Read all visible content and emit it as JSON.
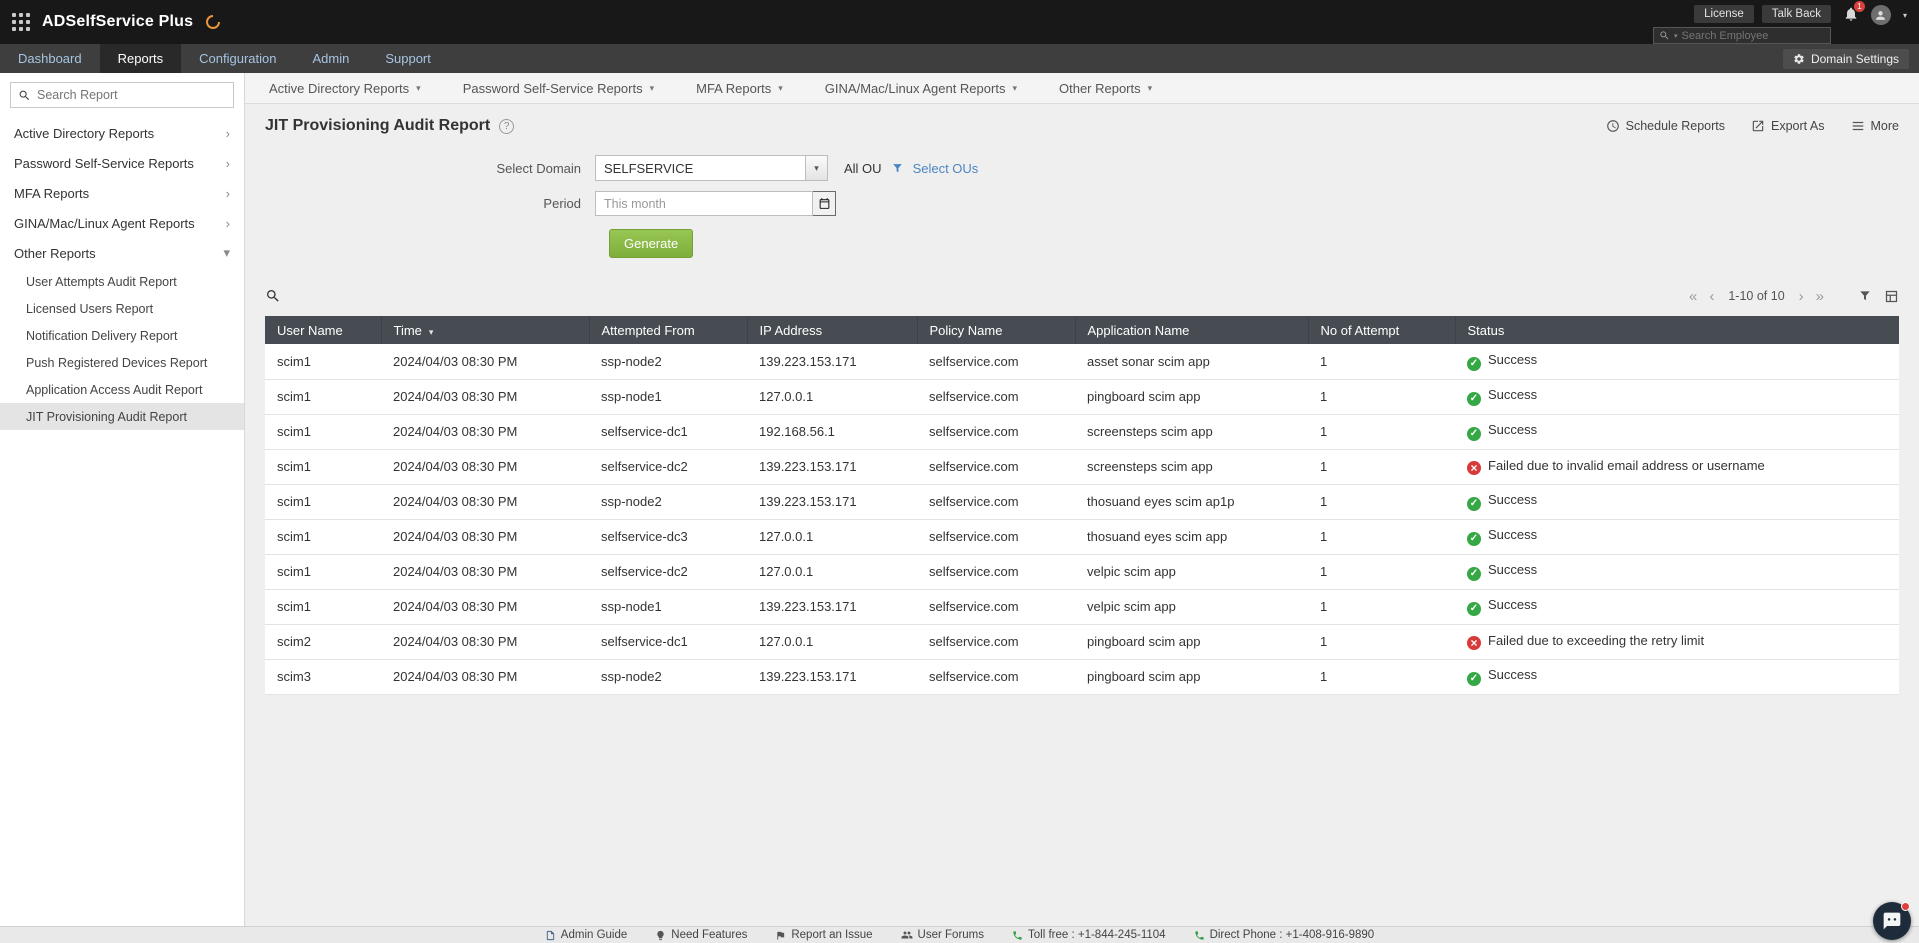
{
  "icons": {
    "caret_down": "▾",
    "chevron_right": "›",
    "first_page": "«",
    "prev_page": "‹",
    "next_page": "›",
    "last_page": "»",
    "help": "?"
  },
  "topbar": {
    "app_name": "ADSelfService Plus",
    "license": "License",
    "talk_back": "Talk Back",
    "bell_badge": "1",
    "search_placeholder": "Search Employee"
  },
  "navbar": {
    "tabs": [
      {
        "label": "Dashboard"
      },
      {
        "label": "Reports"
      },
      {
        "label": "Configuration"
      },
      {
        "label": "Admin"
      },
      {
        "label": "Support"
      }
    ],
    "domain_settings": "Domain Settings"
  },
  "report_menu": {
    "items": [
      {
        "label": "Active Directory Reports"
      },
      {
        "label": "Password Self-Service Reports"
      },
      {
        "label": "MFA Reports"
      },
      {
        "label": "GINA/Mac/Linux Agent Reports"
      },
      {
        "label": "Other Reports"
      }
    ]
  },
  "sidebar": {
    "search_placeholder": "Search Report",
    "groups": [
      {
        "label": "Active Directory Reports"
      },
      {
        "label": "Password Self-Service Reports"
      },
      {
        "label": "MFA Reports"
      },
      {
        "label": "GINA/Mac/Linux Agent Reports"
      },
      {
        "label": "Other Reports"
      }
    ],
    "other_reports_children": [
      {
        "label": "User Attempts Audit Report"
      },
      {
        "label": "Licensed Users Report"
      },
      {
        "label": "Notification Delivery Report"
      },
      {
        "label": "Push Registered Devices Report"
      },
      {
        "label": "Application Access Audit Report"
      },
      {
        "label": "JIT Provisioning Audit Report"
      }
    ]
  },
  "page": {
    "title": "JIT Provisioning Audit Report",
    "actions": {
      "schedule": "Schedule Reports",
      "export": "Export As",
      "more": "More"
    }
  },
  "form": {
    "select_domain_label": "Select Domain",
    "domain_value": "SELFSERVICE",
    "all_ou_label": "All OU",
    "select_ous_label": "Select OUs",
    "period_label": "Period",
    "period_value": "This month",
    "generate_label": "Generate"
  },
  "table": {
    "pagination_range": "1-10 of 10",
    "columns": [
      "User Name",
      "Time",
      "Attempted From",
      "IP Address",
      "Policy Name",
      "Application Name",
      "No of Attempt",
      "Status"
    ],
    "rows": [
      {
        "user": "scim1",
        "time": "2024/04/03 08:30 PM",
        "from": "ssp-node2",
        "ip": "139.223.153.171",
        "policy": "selfservice.com",
        "app": "asset sonar scim app",
        "attempts": "1",
        "status_type": "success",
        "status_text": "Success"
      },
      {
        "user": "scim1",
        "time": "2024/04/03 08:30 PM",
        "from": "ssp-node1",
        "ip": "127.0.0.1",
        "policy": "selfservice.com",
        "app": "pingboard scim app",
        "attempts": "1",
        "status_type": "success",
        "status_text": "Success"
      },
      {
        "user": "scim1",
        "time": "2024/04/03 08:30 PM",
        "from": "selfservice-dc1",
        "ip": "192.168.56.1",
        "policy": "selfservice.com",
        "app": "screensteps scim app",
        "attempts": "1",
        "status_type": "success",
        "status_text": "Success"
      },
      {
        "user": "scim1",
        "time": "2024/04/03 08:30 PM",
        "from": "selfservice-dc2",
        "ip": "139.223.153.171",
        "policy": "selfservice.com",
        "app": "screensteps scim app",
        "attempts": "1",
        "status_type": "failed",
        "status_text": "Failed due to invalid email address or username"
      },
      {
        "user": "scim1",
        "time": "2024/04/03 08:30 PM",
        "from": "ssp-node2",
        "ip": "139.223.153.171",
        "policy": "selfservice.com",
        "app": "thosuand eyes scim ap1p",
        "attempts": "1",
        "status_type": "success",
        "status_text": "Success"
      },
      {
        "user": "scim1",
        "time": "2024/04/03 08:30 PM",
        "from": "selfservice-dc3",
        "ip": "127.0.0.1",
        "policy": "selfservice.com",
        "app": "thosuand eyes scim app",
        "attempts": "1",
        "status_type": "success",
        "status_text": "Success"
      },
      {
        "user": "scim1",
        "time": "2024/04/03 08:30 PM",
        "from": "selfservice-dc2",
        "ip": "127.0.0.1",
        "policy": "selfservice.com",
        "app": "velpic scim app",
        "attempts": "1",
        "status_type": "success",
        "status_text": "Success"
      },
      {
        "user": "scim1",
        "time": "2024/04/03 08:30 PM",
        "from": "ssp-node1",
        "ip": "139.223.153.171",
        "policy": "selfservice.com",
        "app": "velpic scim app",
        "attempts": "1",
        "status_type": "success",
        "status_text": "Success"
      },
      {
        "user": "scim2",
        "time": "2024/04/03 08:30 PM",
        "from": "selfservice-dc1",
        "ip": "127.0.0.1",
        "policy": "selfservice.com",
        "app": "pingboard scim app",
        "attempts": "1",
        "status_type": "failed",
        "status_text": "Failed due to exceeding the retry limit"
      },
      {
        "user": "scim3",
        "time": "2024/04/03 08:30 PM",
        "from": "ssp-node2",
        "ip": "139.223.153.171",
        "policy": "selfservice.com",
        "app": "pingboard scim app",
        "attempts": "1",
        "status_type": "success",
        "status_text": "Success"
      }
    ]
  },
  "footer": {
    "items": [
      {
        "label": "Admin Guide"
      },
      {
        "label": "Need Features"
      },
      {
        "label": "Report an Issue"
      },
      {
        "label": "User Forums"
      },
      {
        "label": "Toll free : +1-844-245-1104"
      },
      {
        "label": "Direct Phone : +1-408-916-9890"
      }
    ]
  }
}
